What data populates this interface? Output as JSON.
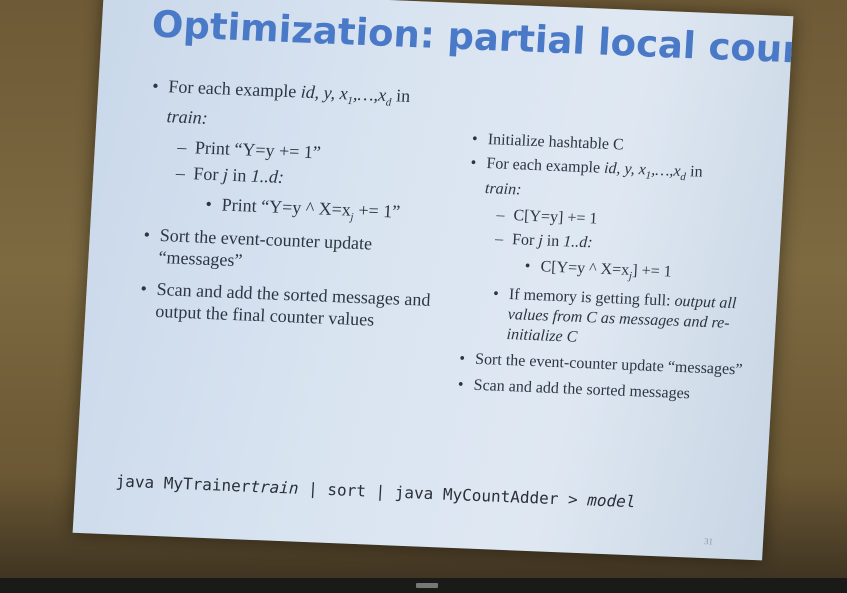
{
  "slide": {
    "title": "Optimization: partial local counting",
    "left": {
      "b1_prefix": "For each example ",
      "b1_vars": "id, y, x",
      "b1_sub1": "1",
      "b1_dots": ",…,x",
      "b1_subd": "d",
      "b1_suffix": " in",
      "b1_train": "train:",
      "s1": "Print “Y=y += 1”",
      "s2_prefix": "For ",
      "s2_j": "j",
      "s2_mid": " in ",
      "s2_range": "1..d:",
      "s3_prefix": "Print “Y=y ^ X=x",
      "s3_sub": "j",
      "s3_suffix": " += 1”",
      "b2": "Sort the event-counter update “messages”",
      "b3": "Scan and add the sorted messages and output the final counter values"
    },
    "right": {
      "b1": "Initialize hashtable C",
      "b2_prefix": "For each example ",
      "b2_vars": "id, y, x",
      "b2_sub1": "1",
      "b2_dots": ",…,x",
      "b2_subd": "d",
      "b2_suffix": " in",
      "b2_train": "train:",
      "s1": "C[Y=y] += 1",
      "s2_prefix": "For ",
      "s2_j": "j",
      "s2_mid": " in ",
      "s2_range": "1..d:",
      "s3_prefix": "C[Y=y ^ X=x",
      "s3_sub": "j",
      "s3_suffix": "] += 1",
      "s4_prefix": "If memory is getting full: ",
      "s4_italic": "output all values from C as messages and re-initialize C",
      "b3": "Sort the event-counter update “messages”",
      "b4": "Scan and add the sorted messages"
    },
    "command": {
      "part1": "java MyTrainer",
      "part2": "train",
      "part3": " | sort | java MyCountAdder > ",
      "part4": "model"
    },
    "page_number": "31"
  },
  "bullets": {
    "round": "•",
    "dash": "–"
  },
  "colors": {
    "title": "#4a79c8",
    "slide_bg": "#d9e4f1",
    "text": "#2d3542"
  }
}
